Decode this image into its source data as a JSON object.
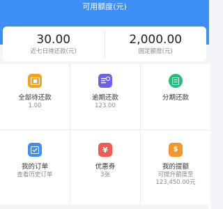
{
  "header": {
    "title": "可用额度(元)",
    "color": "#3d8ff5"
  },
  "summary": {
    "left": {
      "value": "30.00",
      "label": "近七日待还款(元)"
    },
    "right": {
      "value": "2,000.00",
      "label": "固定额度(元)"
    }
  },
  "grid": [
    {
      "key": "all",
      "label": "全部待还款",
      "sub": "1.00",
      "icon": "calendar-icon",
      "color": "#f7a21b"
    },
    {
      "key": "overdue",
      "label": "逾期还款",
      "sub": "123.00",
      "icon": "clock-card-icon",
      "color": "#6c63e8"
    },
    {
      "key": "install",
      "label": "分期还款",
      "sub": "",
      "icon": "ledger-icon",
      "color": "#1fbf7a"
    },
    {
      "key": "orders",
      "label": "我的订单",
      "sub": "查看历史订单",
      "icon": "checklist-icon",
      "color": "#3d8ff5"
    },
    {
      "key": "coupons",
      "label": "优惠券",
      "sub": "3张",
      "icon": "yen-icon",
      "color": "#f25a4f"
    },
    {
      "key": "increase",
      "label": "我的提额",
      "sub": "可提升额度至",
      "sub2": "123,450.00元",
      "icon": "money-bag-icon",
      "color": "#f4962c"
    }
  ]
}
